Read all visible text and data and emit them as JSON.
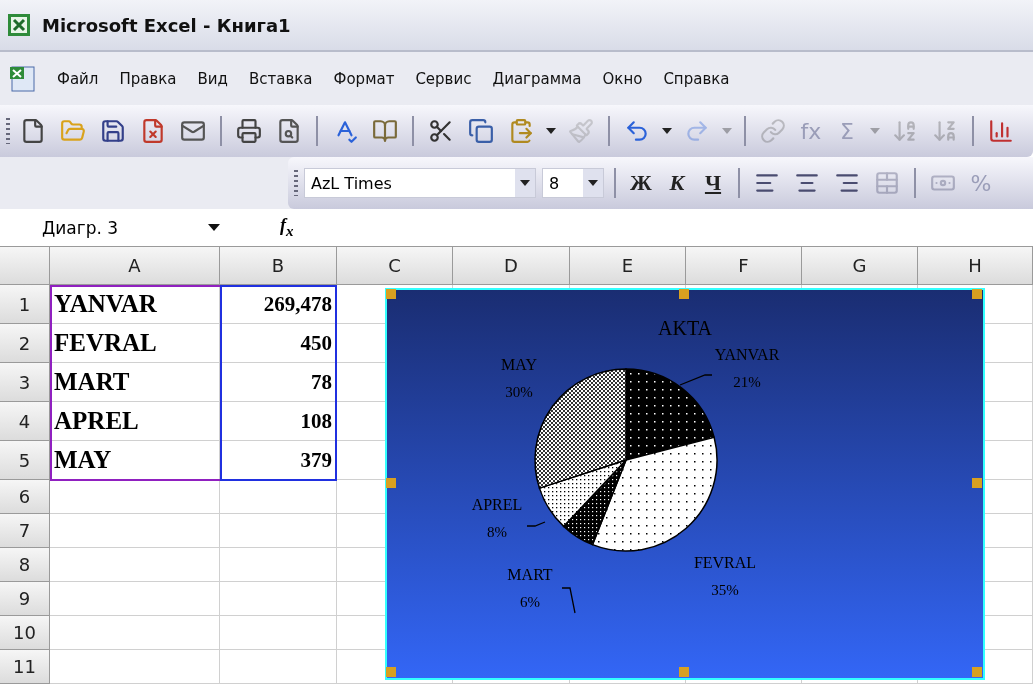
{
  "window": {
    "title": "Microsoft Excel - Книга1"
  },
  "menu": [
    {
      "label": "Файл"
    },
    {
      "label": "Правка"
    },
    {
      "label": "Вид"
    },
    {
      "label": "Вставка"
    },
    {
      "label": "Формат"
    },
    {
      "label": "Сервис"
    },
    {
      "label": "Диаграмма"
    },
    {
      "label": "Окно"
    },
    {
      "label": "Справка"
    }
  ],
  "standard_toolbar": [
    {
      "kind": "icon",
      "disabled": false
    },
    {
      "kind": "icon",
      "disabled": false
    },
    {
      "kind": "icon",
      "disabled": false
    },
    {
      "kind": "icon",
      "disabled": false
    },
    {
      "kind": "icon",
      "disabled": false
    },
    {
      "kind": "separator"
    },
    {
      "kind": "icon",
      "disabled": false
    },
    {
      "kind": "icon",
      "disabled": false
    },
    {
      "kind": "separator"
    },
    {
      "kind": "icon",
      "disabled": false
    },
    {
      "kind": "icon",
      "disabled": false
    },
    {
      "kind": "separator"
    },
    {
      "kind": "icon",
      "disabled": false
    },
    {
      "kind": "icon",
      "disabled": false
    },
    {
      "kind": "icon",
      "disabled": false
    },
    {
      "kind": "caret",
      "disabled": false
    },
    {
      "kind": "icon",
      "disabled": true
    },
    {
      "kind": "separator"
    },
    {
      "kind": "icon",
      "disabled": false
    },
    {
      "kind": "caret",
      "disabled": false
    },
    {
      "kind": "icon",
      "disabled": true
    },
    {
      "kind": "caret",
      "disabled": true
    },
    {
      "kind": "separator"
    },
    {
      "kind": "icon",
      "disabled": true
    },
    {
      "kind": "text",
      "label": "fx",
      "disabled": true
    },
    {
      "kind": "text",
      "label": "Σ",
      "disabled": true
    },
    {
      "kind": "caret",
      "disabled": true
    },
    {
      "kind": "icon",
      "disabled": true
    },
    {
      "kind": "icon",
      "disabled": true
    },
    {
      "kind": "separator"
    },
    {
      "kind": "icon",
      "disabled": false
    }
  ],
  "formatting_toolbar": {
    "font": "AzL Times",
    "size": "8",
    "buttons": [
      {
        "kind": "separator"
      },
      {
        "kind": "bold",
        "label": "Ж",
        "disabled": false
      },
      {
        "kind": "italic",
        "label": "К",
        "disabled": false
      },
      {
        "kind": "underline",
        "label": "Ч",
        "disabled": false
      },
      {
        "kind": "separator"
      },
      {
        "kind": "icon",
        "disabled": false
      },
      {
        "kind": "icon",
        "disabled": false
      },
      {
        "kind": "icon",
        "disabled": false
      },
      {
        "kind": "icon",
        "disabled": true
      },
      {
        "kind": "separator"
      },
      {
        "kind": "icon",
        "disabled": true
      },
      {
        "kind": "text",
        "label": "%",
        "disabled": true
      }
    ]
  },
  "formula_bar": {
    "name_box": "Диагр. 3",
    "function_label": "f$_{x}$"
  },
  "sheet": {
    "columns": [
      "A",
      "B",
      "C",
      "D",
      "E",
      "F",
      "G",
      "H"
    ],
    "row_numbers": [
      "1",
      "2",
      "3",
      "4",
      "5",
      "6",
      "7",
      "8",
      "9",
      "10",
      "11"
    ],
    "rows": [
      {
        "cells": [
          "YANVAR",
          "269,478"
        ]
      },
      {
        "cells": [
          "FEVRAL",
          "450"
        ]
      },
      {
        "cells": [
          "MART",
          "78"
        ]
      },
      {
        "cells": [
          "APREL",
          "108"
        ]
      },
      {
        "cells": [
          "MAY",
          "379"
        ]
      }
    ]
  },
  "chart": {
    "selected": true,
    "chart_data": {
      "type": "pie",
      "title": "AKTA",
      "categories": [
        "YANVAR",
        "FEVRAL",
        "MART",
        "APREL",
        "MAY"
      ],
      "values": [
        21,
        35,
        6,
        8,
        30
      ],
      "value_labels": [
        "21%",
        "35%",
        "6%",
        "8%",
        "30%"
      ]
    }
  }
}
